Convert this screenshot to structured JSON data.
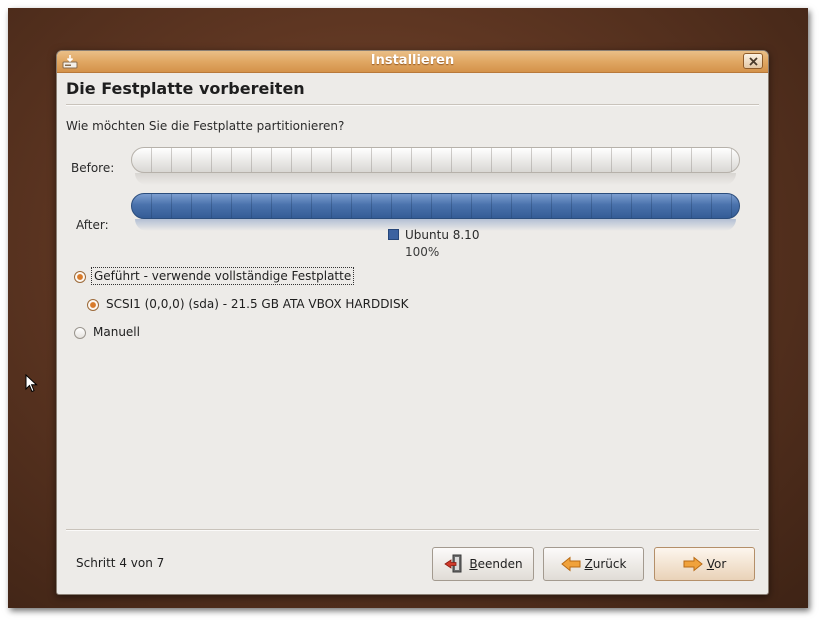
{
  "window": {
    "title": "Installieren",
    "icons": {
      "app": "installer-disk-icon",
      "close": "close-icon"
    }
  },
  "page": {
    "title": "Die Festplatte vorbereiten",
    "question": "Wie möchten Sie die Festplatte partitionieren?"
  },
  "partition_bars": {
    "before_label": "Before:",
    "after_label": "After:",
    "after_legend": {
      "name": "Ubuntu 8.10",
      "percent": "100%",
      "color": "#3c62a0"
    }
  },
  "options": {
    "guided_label": "Geführt - verwende vollständige Festplatte",
    "guided_selected": true,
    "disk_label": "SCSI1 (0,0,0) (sda) - 21.5 GB ATA VBOX HARDDISK",
    "disk_selected": true,
    "manual_label": "Manuell",
    "manual_selected": false
  },
  "footer": {
    "step_text": "Schritt 4 von 7",
    "quit": {
      "mnemonic": "B",
      "rest": "eenden",
      "icon": "quit-icon"
    },
    "back": {
      "mnemonic": "Z",
      "rest": "urück",
      "icon": "arrow-left-icon"
    },
    "forward": {
      "mnemonic": "V",
      "rest": "or",
      "icon": "arrow-right-icon"
    }
  },
  "colors": {
    "titlebar": "#e0a763",
    "accent": "#d97b2b",
    "partition_fill": "#4a72ac"
  }
}
